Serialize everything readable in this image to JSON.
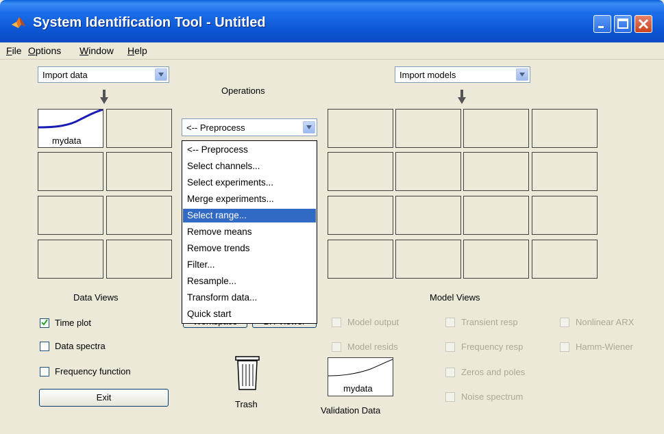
{
  "window": {
    "title": "System Identification Tool - Untitled"
  },
  "menu": [
    {
      "label": "File",
      "mnemonic": "F",
      "rest": "ile"
    },
    {
      "label": "Options",
      "mnemonic": "O",
      "rest": "ptions"
    },
    {
      "label": "Window",
      "mnemonic": "W",
      "rest": "indow"
    },
    {
      "label": "Help",
      "mnemonic": "H",
      "rest": "elp"
    }
  ],
  "data_panel": {
    "import_combo": "Import data",
    "cell_label": "mydata",
    "title": "Data Views",
    "checkboxes": [
      {
        "label": "Time plot",
        "checked": true
      },
      {
        "label": "Data spectra",
        "checked": false
      },
      {
        "label": "Frequency function",
        "checked": false
      }
    ],
    "exit_button": "Exit"
  },
  "operations": {
    "title": "Operations",
    "combo_selected": "<-- Preprocess",
    "options": [
      "<-- Preprocess",
      "Select channels...",
      "Select experiments...",
      "Merge experiments...",
      "Select range...",
      "Remove means",
      "Remove trends",
      "Filter...",
      "Resample...",
      "Transform data...",
      "Quick start"
    ],
    "highlighted_index": 4,
    "hidden_buttons": [
      "Workspace",
      "LTI Viewer"
    ]
  },
  "trash": {
    "label": "Trash"
  },
  "validation": {
    "cell_label": "mydata",
    "title": "Validation Data"
  },
  "model_panel": {
    "import_combo": "Import models",
    "title": "Model Views",
    "checkboxes": [
      {
        "label": "Model output",
        "enabled": false
      },
      {
        "label": "Model resids",
        "enabled": false
      },
      {
        "label": "Transient resp",
        "enabled": false
      },
      {
        "label": "Frequency resp",
        "enabled": false
      },
      {
        "label": "Zeros and poles",
        "enabled": false
      },
      {
        "label": "Noise spectrum",
        "enabled": false
      },
      {
        "label": "Nonlinear ARX",
        "enabled": false
      },
      {
        "label": "Hamm-Wiener",
        "enabled": false
      }
    ]
  },
  "colors": {
    "titlebar": "#0c56d4",
    "data_line": "#1a1ab4",
    "selection": "#316ac5",
    "face": "#ece9d8"
  }
}
